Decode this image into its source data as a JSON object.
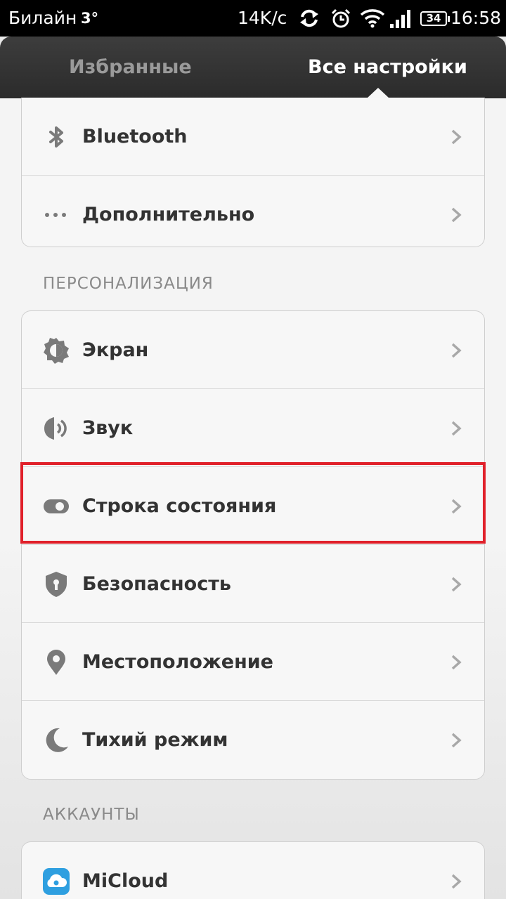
{
  "status_bar": {
    "carrier": "Билайн",
    "network": "3°",
    "speed": "14K/c",
    "battery": "34",
    "time": "16:58",
    "icons": [
      "sync-icon",
      "alarm-icon",
      "wifi-icon",
      "signal-icon",
      "battery-icon"
    ]
  },
  "tabs": {
    "favorites": "Избранные",
    "all_settings": "Все настройки",
    "active": "all_settings"
  },
  "top_group": {
    "items": [
      {
        "label": "Bluetooth",
        "icon": "bluetooth-icon"
      },
      {
        "label": "Дополнительно",
        "icon": "more-dots-icon"
      }
    ]
  },
  "personalization": {
    "header": "ПЕРСОНАЛИЗАЦИЯ",
    "items": [
      {
        "label": "Экран",
        "icon": "brightness-icon"
      },
      {
        "label": "Звук",
        "icon": "speaker-icon"
      },
      {
        "label": "Строка состояния",
        "icon": "toggle-icon",
        "highlighted": true
      },
      {
        "label": "Безопасность",
        "icon": "shield-icon"
      },
      {
        "label": "Местоположение",
        "icon": "location-pin-icon"
      },
      {
        "label": "Тихий режим",
        "icon": "moon-icon"
      }
    ]
  },
  "accounts": {
    "header": "АККАУНТЫ",
    "items": [
      {
        "label": "MiCloud",
        "icon": "micloud-icon"
      }
    ]
  },
  "colors": {
    "highlight": "#e0202a",
    "icon_gray": "#7a7a7a",
    "micloud_blue": "#2e9fe0"
  }
}
